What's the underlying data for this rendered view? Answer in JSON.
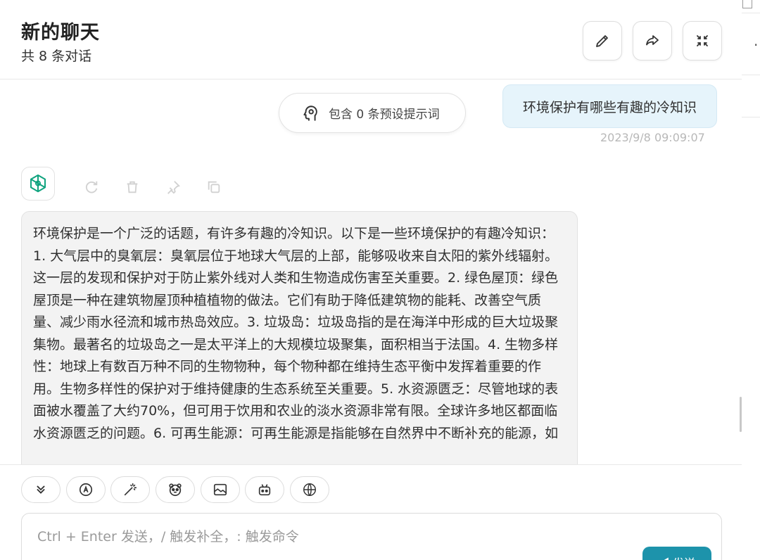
{
  "header": {
    "title": "新的聊天",
    "subtitle": "共 8 条对话",
    "buttons": [
      {
        "name": "edit",
        "icon": "pencil-icon"
      },
      {
        "name": "share",
        "icon": "share-icon"
      },
      {
        "name": "minimize",
        "icon": "collapse-icon"
      }
    ]
  },
  "chat": {
    "preset_prompt_label": "包含 0 条预设提示词",
    "user_message": {
      "text": "环境保护有哪些有趣的冷知识",
      "date": "2023/9/8 09:09:07"
    },
    "bot_message": {
      "avatar_icon": "openai-logo-icon",
      "actions": [
        "refresh-icon",
        "delete-icon",
        "pin-icon",
        "copy-icon"
      ],
      "text": "环境保护是一个广泛的话题，有许多有趣的冷知识。以下是一些环境保护的有趣冷知识：1. 大气层中的臭氧层：臭氧层位于地球大气层的上部，能够吸收来自太阳的紫外线辐射。这一层的发现和保护对于防止紫外线对人类和生物造成伤害至关重要。2. 绿色屋顶：绿色屋顶是一种在建筑物屋顶种植植物的做法。它们有助于降低建筑物的能耗、改善空气质量、减少雨水径流和城市热岛效应。3. 垃圾岛：垃圾岛指的是在海洋中形成的巨大垃圾聚集物。最著名的垃圾岛之一是太平洋上的大规模垃圾聚集，面积相当于法国。4. 生物多样性：地球上有数百万种不同的生物物种，每个物种都在维持生态平衡中发挥着重要的作用。生物多样性的保护对于维持健康的生态系统至关重要。5. 水资源匮乏：尽管地球的表面被水覆盖了大约70%，但可用于饮用和农业的淡水资源非常有限。全球许多地区都面临水资源匮乏的问题。6. 可再生能源：可再生能源是指能够在自然界中不断补充的能源，如"
    }
  },
  "input": {
    "placeholder": "Ctrl + Enter 发送，/ 触发补全，: 触发命令",
    "send_label": "◀ 发送",
    "tools": [
      "chevrons-down-icon",
      "robot-a-icon",
      "magic-wand-icon",
      "mask-icon",
      "image-icon",
      "bot-icon",
      "globe-icon"
    ]
  },
  "colors": {
    "accent": "#1d93ab",
    "user_bubble": "#e6f4fb",
    "bot_bubble": "#f3f3f3"
  }
}
